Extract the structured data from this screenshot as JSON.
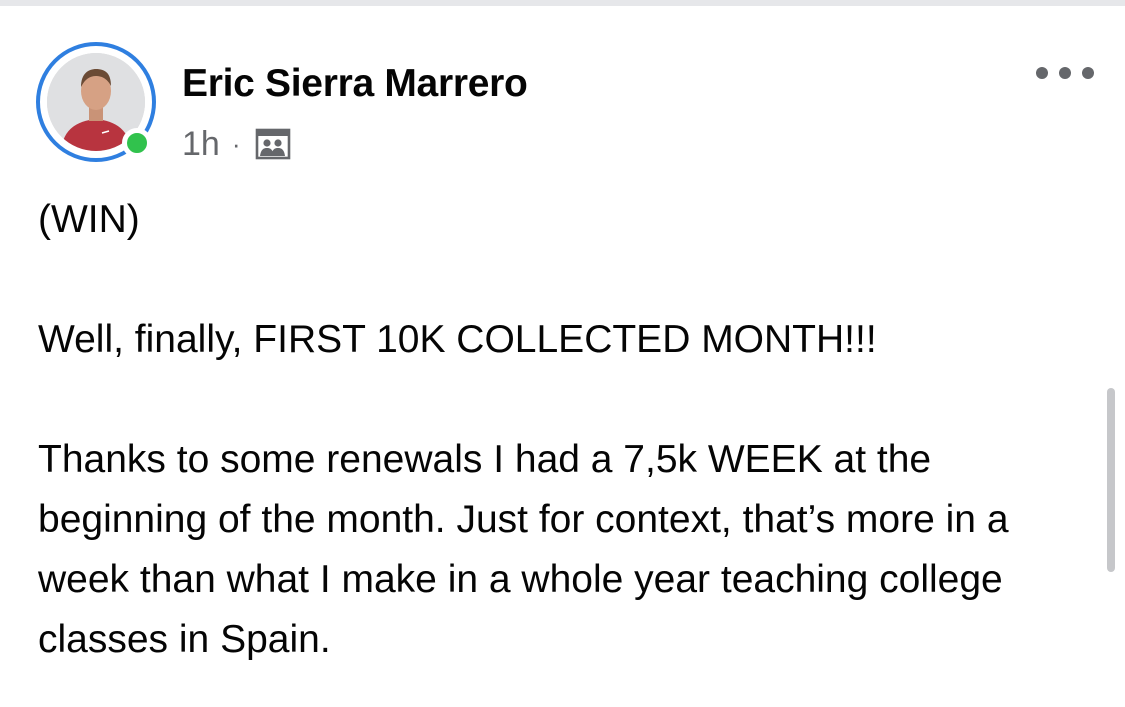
{
  "post": {
    "author": {
      "name": "Eric Sierra Marrero",
      "online": true
    },
    "meta": {
      "timestamp": "1h",
      "separator": "·",
      "audience_icon": "group-photo-icon"
    },
    "more_icon": "more-horizontal-icon",
    "body": {
      "paragraphs": [
        "(WIN)",
        "Well, finally, FIRST 10K COLLECTED MONTH!!!",
        "Thanks to some renewals I had a 7,5k WEEK at the beginning of the month. Just for context, that’s more in a week than what I make in a whole year teaching college classes in Spain."
      ]
    }
  },
  "colors": {
    "ring": "#2f7fe0",
    "online": "#31c24d",
    "meta_text": "#65676b",
    "body_text": "#050505"
  }
}
